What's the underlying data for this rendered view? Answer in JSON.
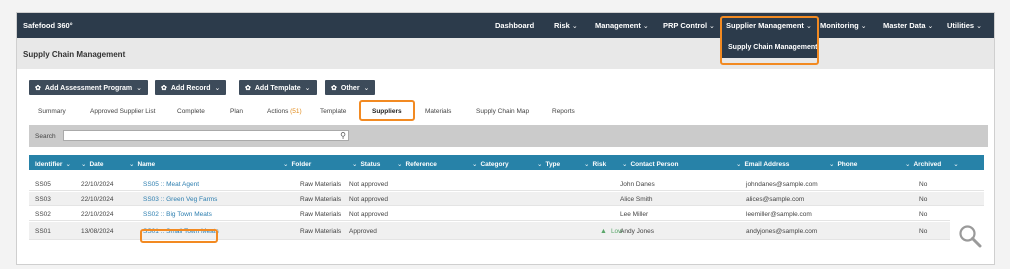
{
  "app": {
    "brand": "Safefood 360°"
  },
  "nav": {
    "items": [
      {
        "label": "Dashboard",
        "chevron": false
      },
      {
        "label": "Risk",
        "chevron": true
      },
      {
        "label": "Management",
        "chevron": true
      },
      {
        "label": "PRP Control",
        "chevron": true
      },
      {
        "label": "Supplier Management",
        "chevron": true
      },
      {
        "label": "Monitoring",
        "chevron": true
      },
      {
        "label": "Master Data",
        "chevron": true
      },
      {
        "label": "Utilities",
        "chevron": true
      }
    ],
    "dropdown_item": "Supply Chain Management"
  },
  "page": {
    "title": "Supply Chain Management"
  },
  "toolbar": {
    "buttons": [
      {
        "label": "Add Assessment Program"
      },
      {
        "label": "Add Record"
      },
      {
        "label": "Add Template"
      },
      {
        "label": "Other"
      }
    ]
  },
  "tabs": [
    {
      "label": "Summary"
    },
    {
      "label": "Approved Supplier List"
    },
    {
      "label": "Complete"
    },
    {
      "label": "Plan"
    },
    {
      "label": "Actions",
      "count": "(51)"
    },
    {
      "label": "Template"
    },
    {
      "label": "Suppliers",
      "active": true
    },
    {
      "label": "Materials"
    },
    {
      "label": "Supply Chain Map"
    },
    {
      "label": "Reports"
    }
  ],
  "search": {
    "label": "Search",
    "value": "",
    "placeholder": ""
  },
  "table": {
    "columns": [
      "Identifier",
      "Date",
      "Name",
      "Folder",
      "Status",
      "Reference",
      "Category",
      "Type",
      "Risk",
      "Contact Person",
      "Email Address",
      "Phone",
      "Archived"
    ],
    "rows": [
      {
        "id": "SS05",
        "date": "22/10/2024",
        "name": "SS05 :: Meat Agent",
        "folder": "Raw Materials",
        "status": "Not approved",
        "risk": "",
        "contact": "John Danes",
        "email": "johndanes@sample.com",
        "archived": "No"
      },
      {
        "id": "SS03",
        "date": "22/10/2024",
        "name": "SS03 :: Green Veg Farms",
        "folder": "Raw Materials",
        "status": "Not approved",
        "risk": "",
        "contact": "Alice Smith",
        "email": "alices@sample.com",
        "archived": "No"
      },
      {
        "id": "SS02",
        "date": "22/10/2024",
        "name": "SS02 :: Big Town Meats",
        "folder": "Raw Materials",
        "status": "Not approved",
        "risk": "",
        "contact": "Lee Miller",
        "email": "leemiller@sample.com",
        "archived": "No"
      },
      {
        "id": "SS01",
        "date": "13/08/2024",
        "name": "SS01 :: Small Town Meats",
        "folder": "Raw Materials",
        "status": "Approved",
        "risk": "Low",
        "contact": "Andy Jones",
        "email": "andyjones@sample.com",
        "archived": "No"
      }
    ]
  },
  "colors": {
    "topbar": "#2c3b4b",
    "table_header": "#2782a8",
    "highlight": "#f28a22",
    "link": "#2e7fb0"
  }
}
